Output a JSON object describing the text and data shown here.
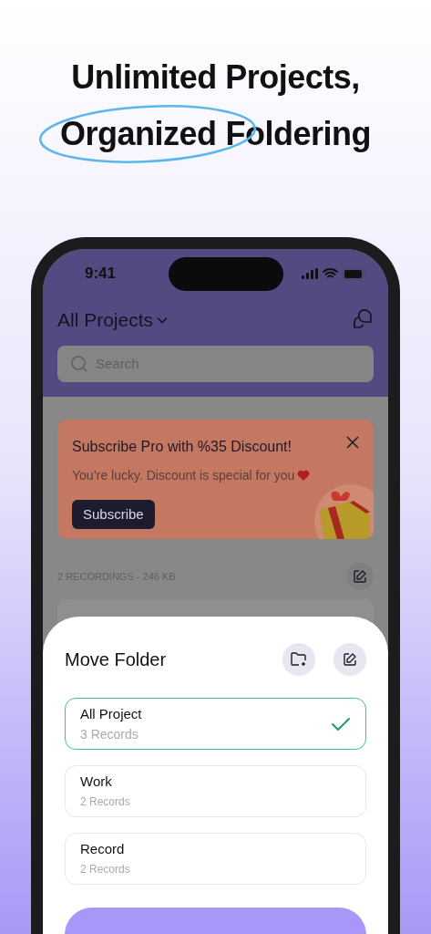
{
  "headline": {
    "line1": "Unlimited Projects,",
    "highlight": "Organized",
    "rest": "Foldering"
  },
  "status_bar": {
    "time": "9:41"
  },
  "header": {
    "title": "All Projects"
  },
  "search": {
    "placeholder": "Search"
  },
  "promo": {
    "title": "Subscribe Pro with %35 Discount!",
    "text": "You’re lucky. Discount is special for you",
    "button": "Subscribe"
  },
  "list_summary": "2 RECORDINGS - 246 KB",
  "sheet": {
    "title": "Move Folder",
    "folders": [
      {
        "name": "All Project",
        "count": "3 Records",
        "selected": true
      },
      {
        "name": "Work",
        "count": "2 Records",
        "selected": false
      },
      {
        "name": "Record",
        "count": "2 Records",
        "selected": false
      }
    ]
  }
}
